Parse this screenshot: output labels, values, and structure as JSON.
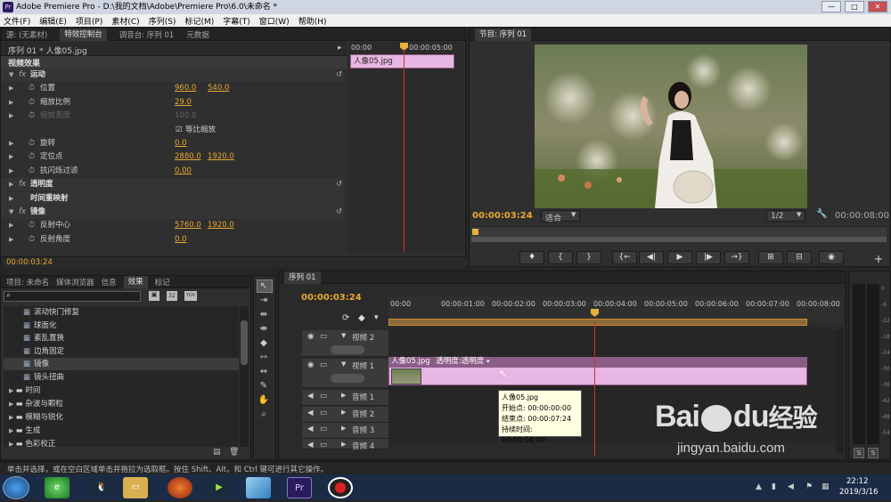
{
  "window": {
    "title": "Adobe Premiere Pro - D:\\我的文档\\Adobe\\Premiere Pro\\6.0\\未命名 *",
    "app_icon": "Pr"
  },
  "menu": [
    "文件(F)",
    "编辑(E)",
    "项目(P)",
    "素材(C)",
    "序列(S)",
    "标记(M)",
    "字幕(T)",
    "窗口(W)",
    "帮助(H)"
  ],
  "source_tabs": [
    "源: (无素材)",
    "特效控制台",
    "调音台: 序列 01",
    "元数据"
  ],
  "effect_controls": {
    "clip_path": "序列 01 * 人像05.jpg",
    "time_start": "00:00",
    "time_mid": "00:00:05:00",
    "clip_label": "人像05.jpg",
    "section_label": "视频效果",
    "rows": [
      {
        "kind": "group",
        "name": "运动",
        "fx": "fx"
      },
      {
        "kind": "prop",
        "name": "位置",
        "v1": "960.0",
        "v2": "540.0"
      },
      {
        "kind": "prop",
        "name": "缩放比例",
        "v1": "29.0"
      },
      {
        "kind": "prop",
        "name": "缩放宽度",
        "v1": "100.0",
        "disabled": true
      },
      {
        "kind": "check",
        "name": "等比缩放"
      },
      {
        "kind": "prop",
        "name": "旋转",
        "v1": "0.0"
      },
      {
        "kind": "prop",
        "name": "定位点",
        "v1": "2880.0",
        "v2": "1920.0"
      },
      {
        "kind": "prop",
        "name": "抗闪烁过滤",
        "v1": "0.00"
      },
      {
        "kind": "group",
        "name": "透明度",
        "fx": "fx"
      },
      {
        "kind": "group",
        "name": "时间重映射",
        "fx": ""
      },
      {
        "kind": "group",
        "name": "镜像",
        "fx": "fx"
      },
      {
        "kind": "prop",
        "name": "反射中心",
        "v1": "5760.0",
        "v2": "1920.0"
      },
      {
        "kind": "prop",
        "name": "反射角度",
        "v1": "0.0"
      }
    ],
    "footer_time": "00:00:03:24"
  },
  "program": {
    "tab": "节目: 序列 01",
    "timecode": "00:00:03:24",
    "fit": "适合",
    "ratio": "1/2",
    "duration": "00:00:08:00",
    "buttons": [
      "♦",
      "{",
      "}",
      "{←",
      "◀|",
      "▶",
      "|▶",
      "→}",
      "⊞",
      "⊟",
      "◉"
    ]
  },
  "project": {
    "tabs": [
      "项目: 未命名",
      "媒体浏览器",
      "信息",
      "效果",
      "标记"
    ],
    "active_tab": "效果",
    "search_placeholder": "",
    "badges": [
      "32",
      "YUV"
    ],
    "items": [
      "滚动快门修复",
      "球面化",
      "紊乱置换",
      "边角固定",
      "镜像",
      "镜头扭曲"
    ],
    "folders": [
      "时间",
      "杂波与颗粒",
      "模糊与锐化",
      "生成",
      "色彩校正"
    ]
  },
  "timeline": {
    "tab": "序列 01",
    "timecode": "00:00:03:24",
    "ruler": [
      "00:00",
      "00:00:01:00",
      "00:00:02:00",
      "00:00:03:00",
      "00:00:04:00",
      "00:00:05:00",
      "00:00:06:00",
      "00:00:07:00",
      "00:00:08:00"
    ],
    "tracks": [
      "视频 2",
      "视频 1",
      "音频 1",
      "音频 2",
      "音频 3",
      "音频 4"
    ],
    "clip_title": "人像05.jpg",
    "clip_effect": "透明度:透明度",
    "tooltip": {
      "name": "人像05.jpg",
      "start": "开始点: 00:00:00:00",
      "end": "结束点: 00:00:07:24",
      "duration": "持续时间: 00:00:08:00"
    }
  },
  "meter": {
    "labels": [
      "0",
      "-6",
      "-12",
      "-18",
      "-24",
      "-30",
      "-36",
      "-42",
      "-48",
      "-54"
    ],
    "solo": [
      "S",
      "S"
    ]
  },
  "status": "单击并选择，或在空白区域单击并拖拉为选取框。按住 Shift、Alt，和 Ctrl 键可进行其它操作。",
  "taskbar": {
    "time": "22:12",
    "date": "2019/3/16"
  },
  "watermark": {
    "brand": "Bai",
    "paw": "du",
    "suffix": "经验",
    "url": "jingyan.baidu.com"
  }
}
